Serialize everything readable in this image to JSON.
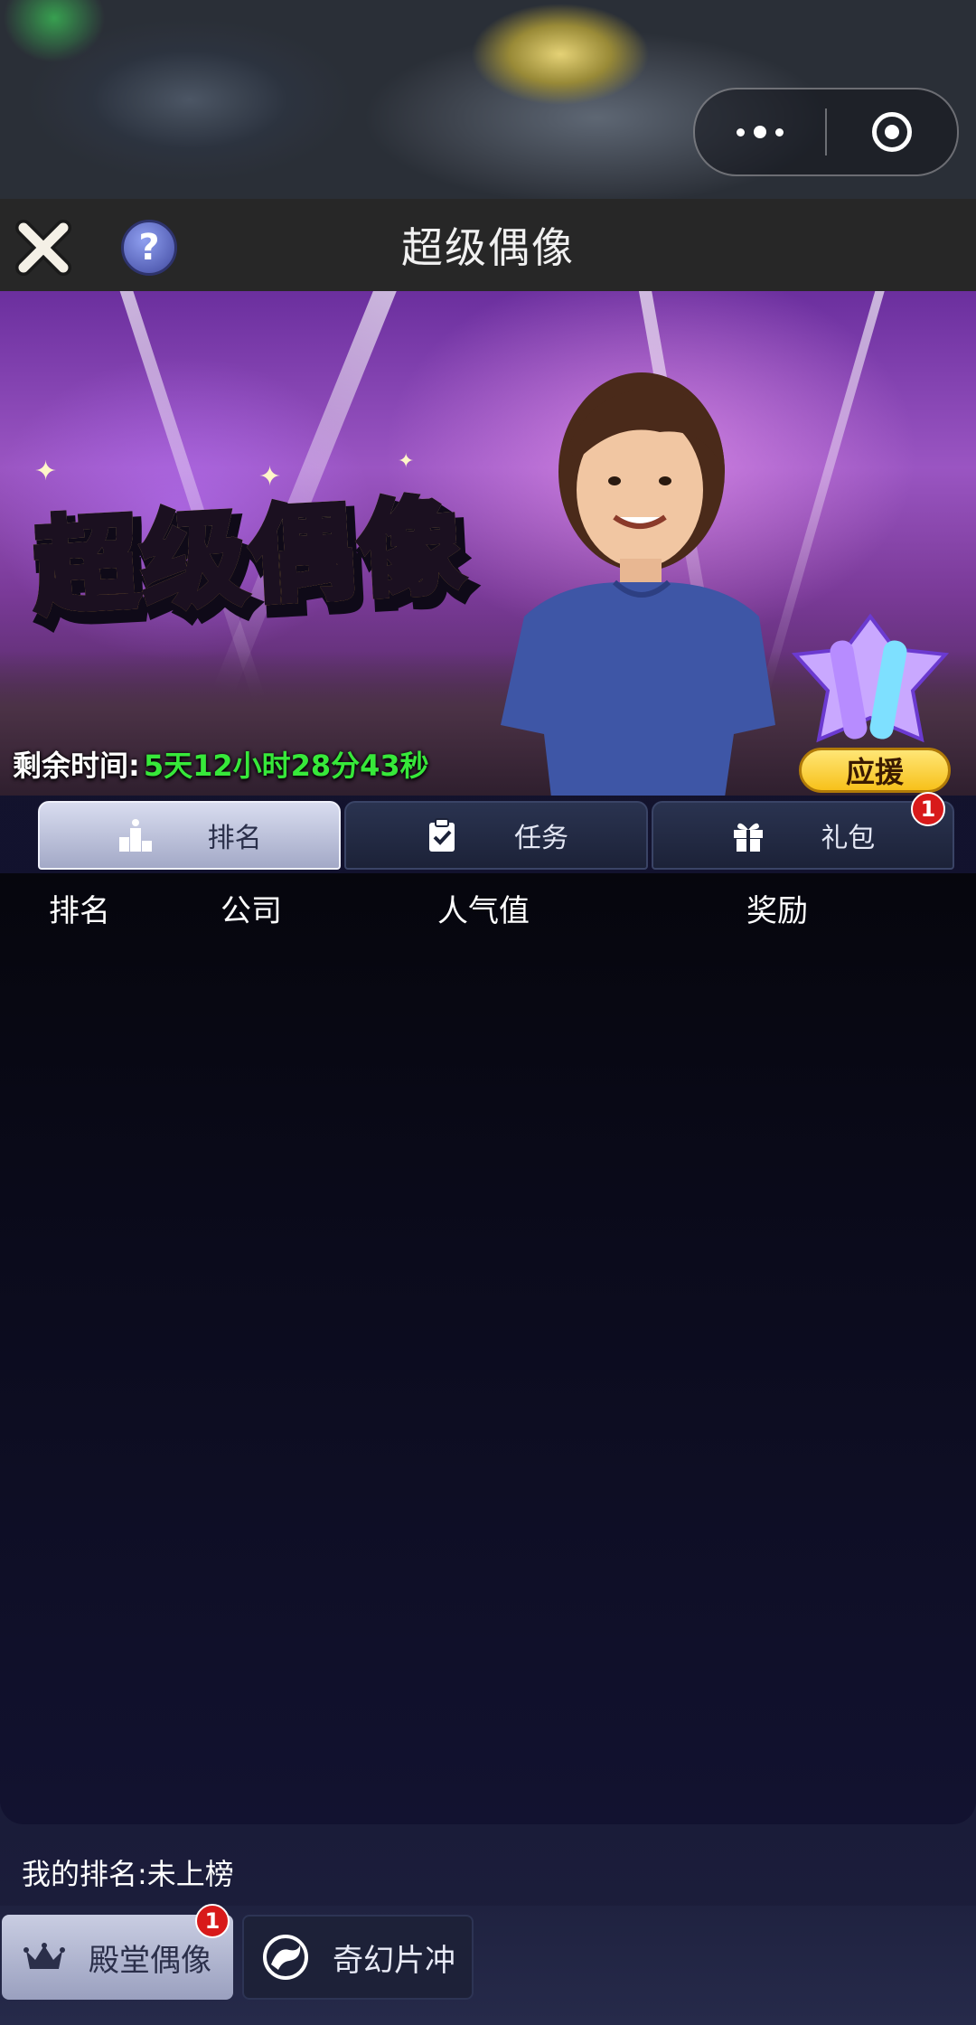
{
  "window": {
    "title": "超级偶像"
  },
  "banner": {
    "logo_text": "超级偶像",
    "timer_label": "剩余时间:",
    "timer_value": "5天12小时28分43秒",
    "support_label": "应援"
  },
  "tabs": [
    {
      "label": "排名",
      "icon": "podium-icon",
      "active": true
    },
    {
      "label": "任务",
      "icon": "clipboard-check-icon",
      "active": false
    },
    {
      "label": "礼包",
      "icon": "gift-icon",
      "active": false,
      "badge": "1"
    }
  ],
  "ranking": {
    "columns": [
      "排名",
      "公司",
      "人气值",
      "奖励"
    ]
  },
  "my_rank": {
    "label": "我的排名:",
    "value": "未上榜"
  },
  "bottom_tabs": [
    {
      "label": "殿堂偶像",
      "icon": "crown-icon",
      "active": true,
      "badge": "1"
    },
    {
      "label": "奇幻片冲",
      "icon": "fantasy-emblem-icon",
      "active": false
    }
  ],
  "colors": {
    "timer_value": "#37e83a",
    "badge": "#d81a1a",
    "support_button": "#f7c11b"
  }
}
